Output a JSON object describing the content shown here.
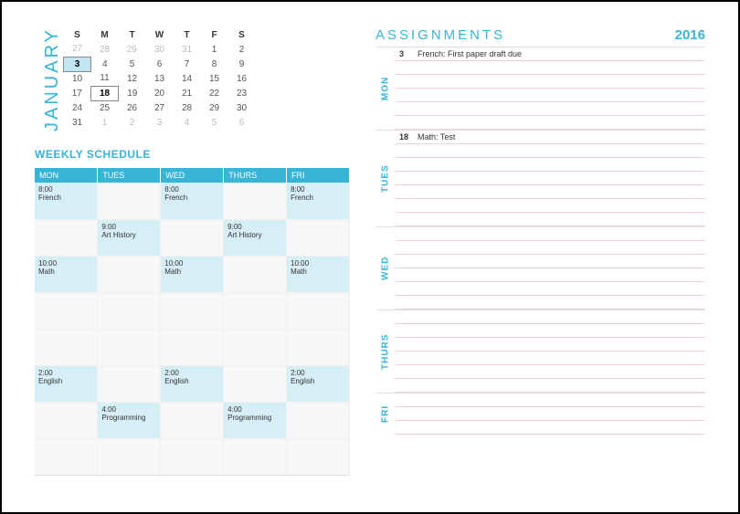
{
  "month_label": "JANUARY",
  "year": "2016",
  "cal": {
    "dow": [
      "S",
      "M",
      "T",
      "W",
      "T",
      "F",
      "S"
    ],
    "rows": [
      [
        {
          "n": "27",
          "f": 1
        },
        {
          "n": "28",
          "f": 1
        },
        {
          "n": "29",
          "f": 1
        },
        {
          "n": "30",
          "f": 1
        },
        {
          "n": "31",
          "f": 1
        },
        {
          "n": "1"
        },
        {
          "n": "2"
        }
      ],
      [
        {
          "n": "3",
          "sel": 1
        },
        {
          "n": "4"
        },
        {
          "n": "5"
        },
        {
          "n": "6"
        },
        {
          "n": "7"
        },
        {
          "n": "8"
        },
        {
          "n": "9"
        }
      ],
      [
        {
          "n": "10"
        },
        {
          "n": "11"
        },
        {
          "n": "12"
        },
        {
          "n": "13"
        },
        {
          "n": "14"
        },
        {
          "n": "15"
        },
        {
          "n": "16"
        }
      ],
      [
        {
          "n": "17"
        },
        {
          "n": "18",
          "today": 1
        },
        {
          "n": "19"
        },
        {
          "n": "20"
        },
        {
          "n": "21"
        },
        {
          "n": "22"
        },
        {
          "n": "23"
        }
      ],
      [
        {
          "n": "24"
        },
        {
          "n": "25"
        },
        {
          "n": "26"
        },
        {
          "n": "27"
        },
        {
          "n": "28"
        },
        {
          "n": "29"
        },
        {
          "n": "30"
        }
      ],
      [
        {
          "n": "31"
        },
        {
          "n": "1",
          "f": 1
        },
        {
          "n": "2",
          "f": 1
        },
        {
          "n": "3",
          "f": 1
        },
        {
          "n": "4",
          "f": 1
        },
        {
          "n": "5",
          "f": 1
        },
        {
          "n": "6",
          "f": 1
        }
      ]
    ]
  },
  "ws_title": "WEEKLY SCHEDULE",
  "ws_headers": [
    "MON",
    "TUES",
    "WED",
    "THURS",
    "FRI"
  ],
  "ws_rows": [
    [
      {
        "t": "8:00",
        "s": "French"
      },
      {},
      {
        "t": "8:00",
        "s": "French"
      },
      {},
      {
        "t": "8:00",
        "s": "French"
      }
    ],
    [
      {},
      {
        "t": "9:00",
        "s": "Art History"
      },
      {},
      {
        "t": "9:00",
        "s": "Art History"
      },
      {}
    ],
    [
      {
        "t": "10:00",
        "s": "Math"
      },
      {},
      {
        "t": "10:00",
        "s": "Math"
      },
      {},
      {
        "t": "10:00",
        "s": "Math"
      }
    ],
    [
      {},
      {},
      {},
      {},
      {}
    ],
    [
      {},
      {},
      {},
      {},
      {}
    ],
    [
      {
        "t": "2:00",
        "s": "English"
      },
      {},
      {
        "t": "2:00",
        "s": "English"
      },
      {},
      {
        "t": "2:00",
        "s": "English"
      }
    ],
    [
      {},
      {
        "t": "4:00",
        "s": "Programming"
      },
      {},
      {
        "t": "4:00",
        "s": "Programming"
      },
      {}
    ],
    [
      {},
      {},
      {},
      {},
      {}
    ]
  ],
  "assign_title": "ASSIGNMENTS",
  "assign_days": [
    {
      "label": "MON",
      "lines": 6,
      "items": [
        {
          "row": 0,
          "date": "3",
          "text": "French: First paper draft due"
        }
      ]
    },
    {
      "label": "TUES",
      "lines": 7,
      "items": [
        {
          "row": 0,
          "date": "18",
          "text": "Math: Test"
        }
      ]
    },
    {
      "label": "WED",
      "lines": 6,
      "items": []
    },
    {
      "label": "THURS",
      "lines": 6,
      "items": []
    },
    {
      "label": "FRI",
      "lines": 3,
      "items": []
    }
  ]
}
